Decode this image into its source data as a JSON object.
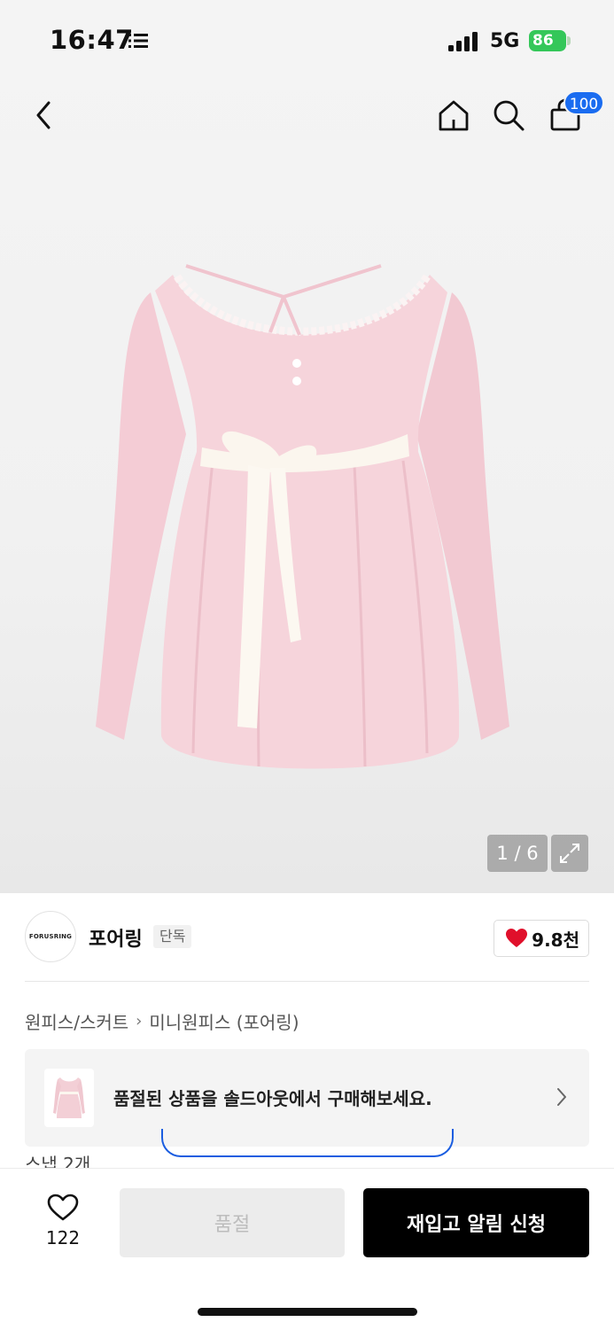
{
  "status_bar": {
    "time": "16:47",
    "network": "5G",
    "battery": "86"
  },
  "nav": {
    "cart_badge": "100",
    "icons": [
      "back-icon",
      "home-icon",
      "search-icon",
      "cart-icon"
    ]
  },
  "gallery": {
    "counter": "1 / 6"
  },
  "brand": {
    "logo_text": "FORUSRING",
    "name": "포어링",
    "badge": "단독",
    "likes": "9.8천",
    "like_color": "#e0102b"
  },
  "breadcrumb": {
    "category": "원피스/스커트",
    "subcategory": "미니원피스 (포어링)"
  },
  "soldout_banner": {
    "text": "품절된 상품을 솔드아웃에서 구매해보세요."
  },
  "peek": {
    "text": "스냅 2개"
  },
  "bottom_bar": {
    "wish_count": "122",
    "soldout_label": "품절",
    "restock_label": "재입고 알림 신청"
  },
  "colors": {
    "accent_blue": "#1a6cf0",
    "battery_green": "#34c759",
    "dress_pink": "#f5d3da"
  }
}
